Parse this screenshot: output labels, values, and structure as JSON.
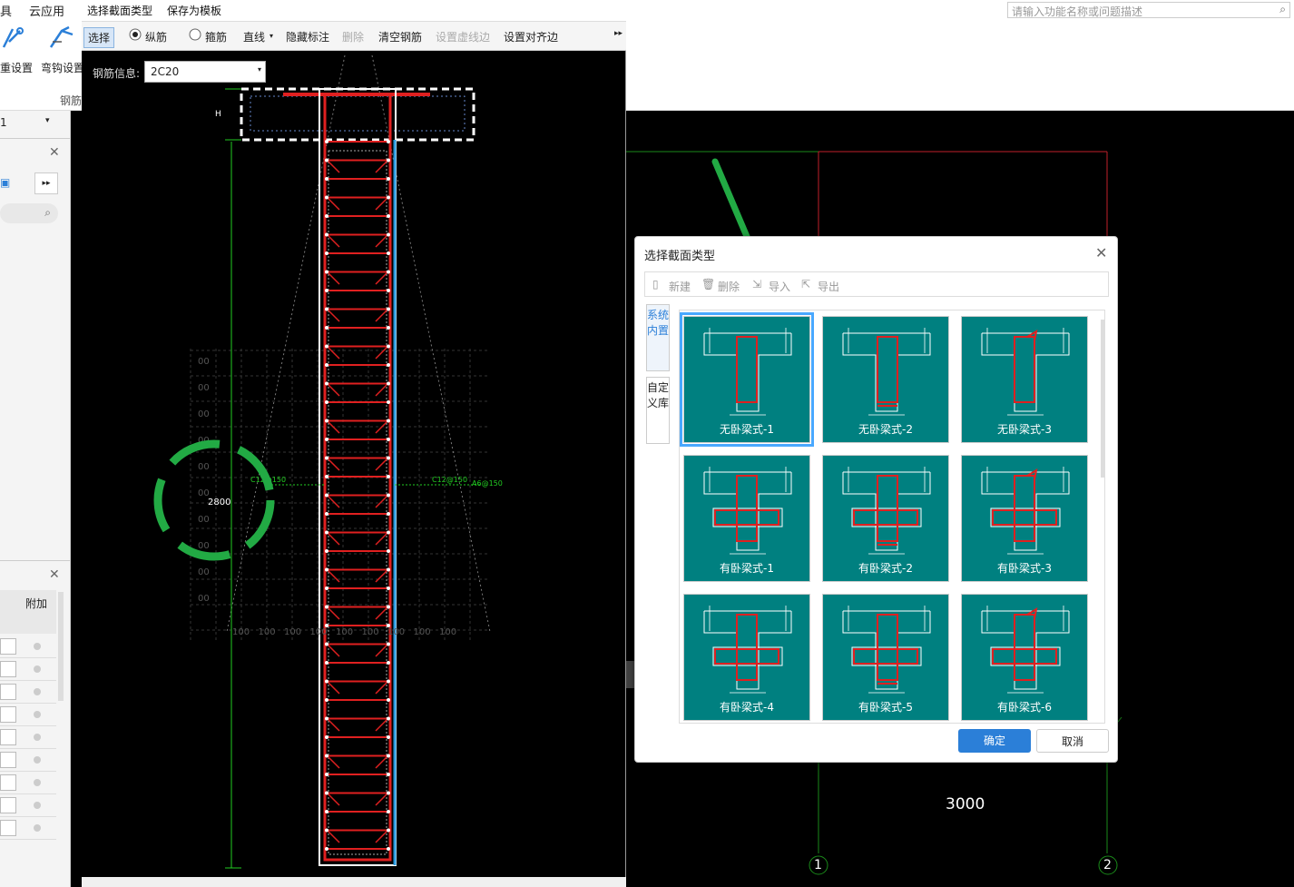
{
  "app": {
    "top_menu": [
      "具",
      "云应用"
    ],
    "ribbon_buttons": [
      "重设置",
      "弯钩设置"
    ],
    "ribbon_group": "钢筋",
    "search_placeholder": "请输入功能名称或问题描述",
    "left_dropdown": "1",
    "left_column_header": "附加"
  },
  "editor": {
    "menu": [
      "选择截面类型",
      "保存为模板"
    ],
    "tools": {
      "select": "选择",
      "radio_long": "纵筋",
      "radio_stirrup": "箍筋",
      "line": "直线",
      "hide_label": "隐藏标注",
      "delete": "删除",
      "clear_rebar": "清空钢筋",
      "set_dashed": "设置虚线边",
      "set_align": "设置对齐边"
    },
    "rebar_info_label": "钢筋信息:",
    "rebar_info_value": "2C20",
    "dim_2800": "2800",
    "dim_H": "H",
    "label_c_left": "C12@150",
    "label_c_right": "C12@150",
    "label_a": "A6@150",
    "grid_labels": [
      "00",
      "00",
      "00",
      "00",
      "00",
      "00",
      "00",
      "00",
      "00",
      "00"
    ],
    "bottom_labels": [
      "100",
      "100",
      "100",
      "100",
      "100",
      "100",
      "100",
      "100",
      "100"
    ]
  },
  "drawing": {
    "dim_3000": "3000",
    "axis_1": "1",
    "axis_2": "2"
  },
  "dialog": {
    "title": "选择截面类型",
    "toolbar": [
      "新建",
      "删除",
      "导入",
      "导出"
    ],
    "side_tabs": [
      "系统内置",
      "自定义库"
    ],
    "cards": [
      {
        "label": "无卧梁式-1",
        "selected": true
      },
      {
        "label": "无卧梁式-2",
        "selected": false
      },
      {
        "label": "无卧梁式-3",
        "selected": false
      },
      {
        "label": "有卧梁式-1",
        "selected": false
      },
      {
        "label": "有卧梁式-2",
        "selected": false
      },
      {
        "label": "有卧梁式-3",
        "selected": false
      },
      {
        "label": "有卧梁式-4",
        "selected": false
      },
      {
        "label": "有卧梁式-5",
        "selected": false
      },
      {
        "label": "有卧梁式-6",
        "selected": false
      }
    ],
    "ok": "确定",
    "cancel": "取消"
  },
  "colors": {
    "card_bg": "#008080",
    "rebar": "#e02020",
    "accent": "#2b7fd8",
    "annotation_green": "#22aa44"
  }
}
